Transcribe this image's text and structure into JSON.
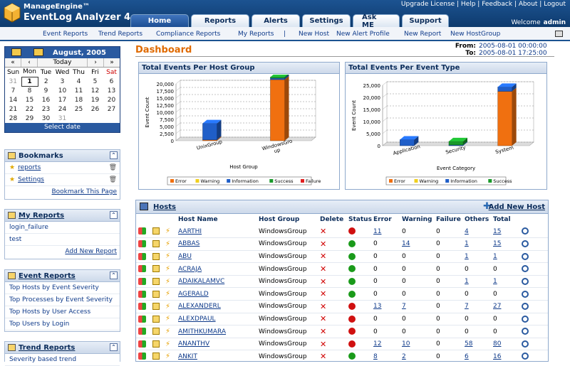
{
  "header": {
    "brand_top": "ManageEngine™",
    "brand_bottom": "EventLog Analyzer 4",
    "tabs": [
      "Home",
      "Reports",
      "Alerts",
      "Settings",
      "Ask ME",
      "Support"
    ],
    "top_links": "Upgrade License  |  Help  |  Feedback  |  About  |  Logout",
    "welcome_label": "Welcome",
    "user": "admin"
  },
  "subnav": [
    "Event Reports",
    "Trend Reports",
    "Compliance Reports",
    "My Reports",
    "|",
    "New Host",
    "New Alert Profile",
    "New Report",
    "New HostGroup"
  ],
  "calendar": {
    "month": "August, 2005",
    "nav": [
      "«",
      "‹",
      "Today",
      "›",
      "»"
    ],
    "days": [
      "Sun",
      "Mon",
      "Tue",
      "Wed",
      "Thu",
      "Fri",
      "Sat"
    ],
    "weeks": [
      [
        "31",
        "1",
        "2",
        "3",
        "4",
        "5",
        "6"
      ],
      [
        "7",
        "8",
        "9",
        "10",
        "11",
        "12",
        "13"
      ],
      [
        "14",
        "15",
        "16",
        "17",
        "18",
        "19",
        "20"
      ],
      [
        "21",
        "22",
        "23",
        "24",
        "25",
        "26",
        "27"
      ],
      [
        "28",
        "29",
        "30",
        "31",
        "",
        "",
        ""
      ]
    ],
    "select_label": "Select date"
  },
  "bookmarks": {
    "title": "Bookmarks",
    "items": [
      "reports",
      "Settings"
    ],
    "footer": "Bookmark This Page"
  },
  "my_reports": {
    "title": "My Reports",
    "items": [
      "login_failure",
      "test"
    ],
    "footer": "Add New Report"
  },
  "event_reports": {
    "title": "Event Reports",
    "items": [
      "Top Hosts by Event Severity",
      "Top Processes by Event Severity",
      "Top Hosts by User Access",
      "Top Users by Login"
    ]
  },
  "trend_reports": {
    "title": "Trend Reports",
    "items": [
      "Severity based trend"
    ]
  },
  "dashboard": {
    "title": "Dashboard",
    "from_label": "From:",
    "from": "2005-08-01 00:00:00",
    "to_label": "To:",
    "to": "2005-08-01 17:25:00"
  },
  "chart_data": [
    {
      "type": "bar",
      "title": "Total Events Per Host Group",
      "xlabel": "Host Group",
      "ylabel": "Event Count",
      "categories": [
        "UnixGroup",
        "WindowsGroup"
      ],
      "y_ticks": [
        "0",
        "2,500",
        "5,000",
        "7,500",
        "10,000",
        "12,500",
        "15,000",
        "17,500",
        "20,000"
      ],
      "ylim": [
        0,
        20000
      ],
      "series": [
        {
          "name": "Error",
          "color": "#f07010",
          "values": [
            300,
            21500
          ]
        },
        {
          "name": "Warning",
          "color": "#f0d020",
          "values": [
            0,
            0
          ]
        },
        {
          "name": "Information",
          "color": "#1f5ec8",
          "values": [
            5800,
            500
          ]
        },
        {
          "name": "Success",
          "color": "#1a9a2a",
          "values": [
            0,
            400
          ]
        },
        {
          "name": "Failure",
          "color": "#e02020",
          "values": [
            0,
            0
          ]
        }
      ]
    },
    {
      "type": "bar",
      "title": "Total Events Per Event Type",
      "xlabel": "Event Category",
      "ylabel": "Event Count",
      "categories": [
        "Application",
        "Security",
        "System"
      ],
      "y_ticks": [
        "0",
        "5,000",
        "10,000",
        "15,000",
        "20,000",
        "25,000"
      ],
      "ylim": [
        0,
        25000
      ],
      "series": [
        {
          "name": "Error",
          "color": "#f07010",
          "values": [
            0,
            0,
            22500
          ]
        },
        {
          "name": "Warning",
          "color": "#f0d020",
          "values": [
            0,
            0,
            0
          ]
        },
        {
          "name": "Information",
          "color": "#1f5ec8",
          "values": [
            2500,
            300,
            1800
          ]
        },
        {
          "name": "Success",
          "color": "#1a9a2a",
          "values": [
            0,
            1500,
            0
          ]
        }
      ]
    }
  ],
  "hosts": {
    "title": "Hosts",
    "add_label": "Add New Host",
    "columns": [
      "",
      "",
      "",
      "Host Name",
      "Host Group",
      "Delete",
      "Status",
      "Error",
      "Warning",
      "Failure",
      "Others",
      "Total",
      ""
    ],
    "rows": [
      {
        "name": "AARTHI",
        "group": "WindowsGroup",
        "status": "down",
        "error": "11",
        "warning": "0",
        "failure": "0",
        "others": "4",
        "total": "15"
      },
      {
        "name": "ABBAS",
        "group": "WindowsGroup",
        "status": "up",
        "error": "0",
        "warning": "14",
        "failure": "0",
        "others": "1",
        "total": "15"
      },
      {
        "name": "ABU",
        "group": "WindowsGroup",
        "status": "up",
        "error": "0",
        "warning": "0",
        "failure": "0",
        "others": "1",
        "total": "1"
      },
      {
        "name": "ACRAJA",
        "group": "WindowsGroup",
        "status": "up",
        "error": "0",
        "warning": "0",
        "failure": "0",
        "others": "0",
        "total": "0"
      },
      {
        "name": "ADAIKALAMVC",
        "group": "WindowsGroup",
        "status": "up",
        "error": "0",
        "warning": "0",
        "failure": "0",
        "others": "1",
        "total": "1"
      },
      {
        "name": "AGERALD",
        "group": "WindowsGroup",
        "status": "up",
        "error": "0",
        "warning": "0",
        "failure": "0",
        "others": "0",
        "total": "0"
      },
      {
        "name": "ALEXANDERL",
        "group": "WindowsGroup",
        "status": "down",
        "error": "13",
        "warning": "7",
        "failure": "0",
        "others": "7",
        "total": "27"
      },
      {
        "name": "ALEXDPAUL",
        "group": "WindowsGroup",
        "status": "down",
        "error": "0",
        "warning": "0",
        "failure": "0",
        "others": "0",
        "total": "0"
      },
      {
        "name": "AMITHKUMARA",
        "group": "WindowsGroup",
        "status": "down",
        "error": "0",
        "warning": "0",
        "failure": "0",
        "others": "0",
        "total": "0"
      },
      {
        "name": "ANANTHV",
        "group": "WindowsGroup",
        "status": "down",
        "error": "12",
        "warning": "10",
        "failure": "0",
        "others": "58",
        "total": "80"
      },
      {
        "name": "ANKIT",
        "group": "WindowsGroup",
        "status": "up",
        "error": "8",
        "warning": "2",
        "failure": "0",
        "others": "6",
        "total": "16"
      }
    ]
  }
}
